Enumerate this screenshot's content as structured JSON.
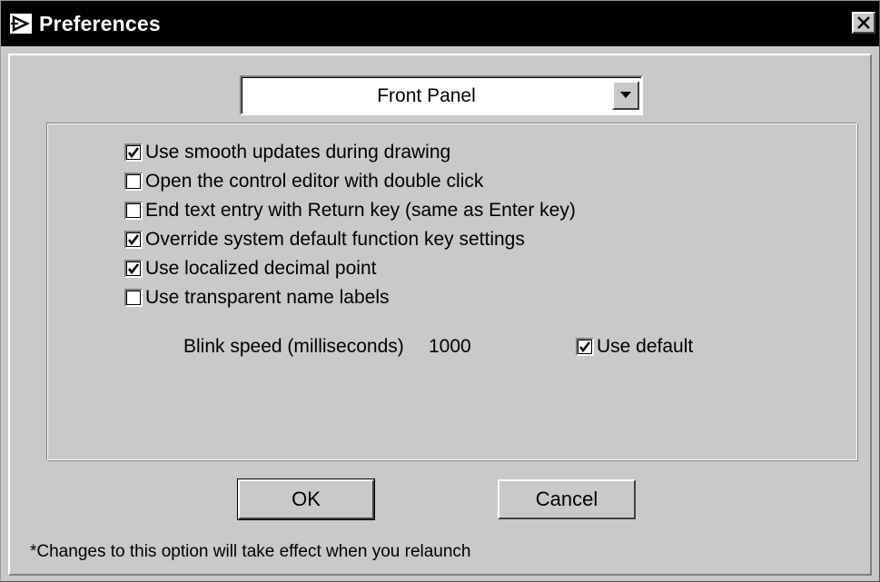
{
  "window": {
    "title": "Preferences",
    "app_icon": "labview-run-arrow-icon",
    "close_icon": "close-icon"
  },
  "category": {
    "selected": "Front Panel"
  },
  "options": [
    {
      "label": "Use smooth updates during drawing",
      "checked": true
    },
    {
      "label": "Open the control editor with double click",
      "checked": false
    },
    {
      "label": "End text entry with Return key (same as Enter key)",
      "checked": false
    },
    {
      "label": "Override system default function key settings",
      "checked": true
    },
    {
      "label": "Use localized decimal point",
      "checked": true
    },
    {
      "label": "Use transparent name labels",
      "checked": false
    }
  ],
  "blink": {
    "label": "Blink speed (milliseconds)",
    "value": "1000",
    "use_default_label": "Use default",
    "use_default_checked": true
  },
  "buttons": {
    "ok_label": "OK",
    "cancel_label": "Cancel"
  },
  "footnote": "*Changes to this option will take effect when you relaunch",
  "colors": {
    "titlebar": "#000000",
    "face": "#c9c9c9"
  }
}
